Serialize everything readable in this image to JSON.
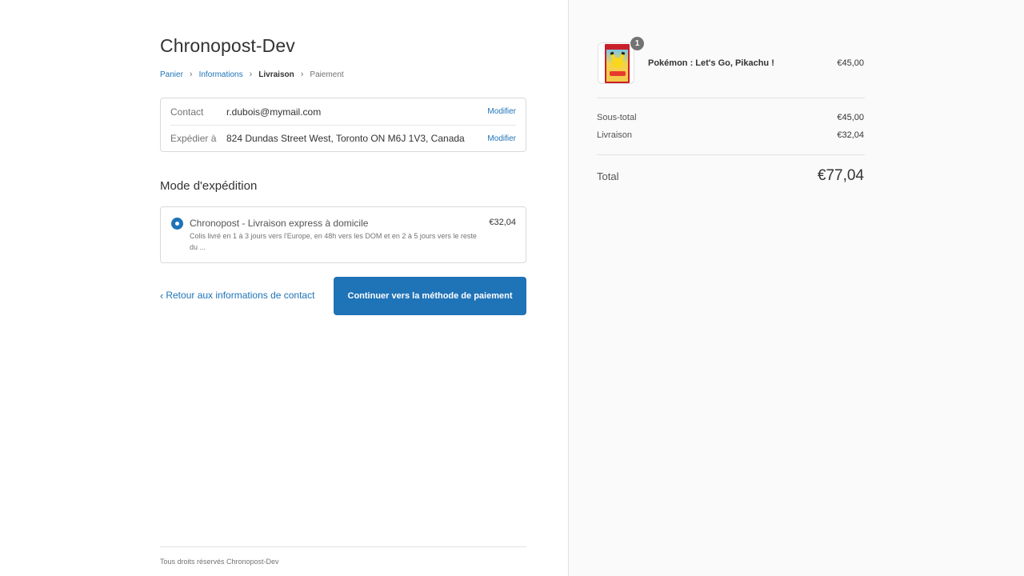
{
  "header": {
    "shop_name": "Chronopost-Dev"
  },
  "breadcrumb": {
    "items": [
      {
        "label": "Panier",
        "state": "link"
      },
      {
        "label": "Informations",
        "state": "link"
      },
      {
        "label": "Livraison",
        "state": "current"
      },
      {
        "label": "Paiement",
        "state": "upcoming"
      }
    ]
  },
  "review": {
    "contact": {
      "label": "Contact",
      "value": "r.dubois@mymail.com",
      "action": "Modifier"
    },
    "ship_to": {
      "label": "Expédier à",
      "value": "824 Dundas Street West, Toronto ON M6J 1V3, Canada",
      "action": "Modifier"
    }
  },
  "shipping": {
    "section_title": "Mode d'expédition",
    "options": [
      {
        "name": "Chronopost - Livraison express à domicile",
        "description": "Colis livré en 1 à 3 jours vers l'Europe, en 48h vers les DOM et en 2 à 5 jours vers le reste du ...",
        "price": "€32,04",
        "selected": true
      }
    ]
  },
  "actions": {
    "back_label": "Retour aux informations de contact",
    "continue_label": "Continuer vers la méthode de paiement"
  },
  "footer": {
    "text": "Tous droits réservés Chronopost-Dev"
  },
  "order_summary": {
    "product": {
      "name": "Pokémon : Let's Go, Pikachu !",
      "price": "€45,00",
      "quantity": "1",
      "image_icon": "game-cover-pikachu"
    },
    "subtotal": {
      "label": "Sous-total",
      "value": "€45,00"
    },
    "shipping": {
      "label": "Livraison",
      "value": "€32,04"
    },
    "total": {
      "label": "Total",
      "value": "€77,04"
    }
  },
  "colors": {
    "accent": "#1f73b7",
    "sidebar_bg": "#fafafa",
    "border": "#d9d9d9",
    "text": "#333333",
    "muted": "#737373"
  }
}
